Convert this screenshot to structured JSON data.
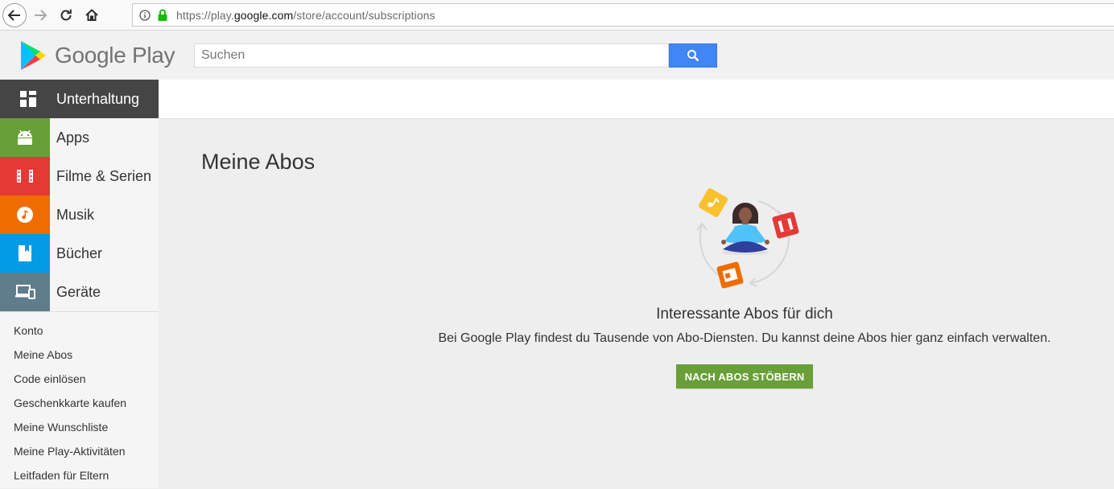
{
  "browser": {
    "url_prefix": "https://play.",
    "url_domain": "google.com",
    "url_path": "/store/account/subscriptions"
  },
  "header": {
    "logo_text": "Google Play",
    "search_placeholder": "Suchen"
  },
  "sidebar": {
    "categories": [
      {
        "label": "Unterhaltung",
        "color": "#454545",
        "icon": "grid-icon"
      },
      {
        "label": "Apps",
        "color": "#689f38",
        "icon": "android-icon"
      },
      {
        "label": "Filme & Serien",
        "color": "#e53935",
        "icon": "film-icon"
      },
      {
        "label": "Musik",
        "color": "#ef6c00",
        "icon": "music-note-icon"
      },
      {
        "label": "Bücher",
        "color": "#039be5",
        "icon": "book-icon"
      },
      {
        "label": "Geräte",
        "color": "#607d8b",
        "icon": "devices-icon"
      }
    ],
    "account_links": [
      "Konto",
      "Meine Abos",
      "Code einlösen",
      "Geschenkkarte kaufen",
      "Meine Wunschliste",
      "Meine Play-Aktivitäten",
      "Leitfaden für Eltern"
    ]
  },
  "main": {
    "title": "Meine Abos",
    "empty_title": "Interessante Abos für dich",
    "empty_desc": "Bei Google Play findest du Tausende von Abo-Diensten. Du kannst deine Abos hier ganz einfach verwalten.",
    "browse_button": "NACH ABOS STÖBERN"
  }
}
